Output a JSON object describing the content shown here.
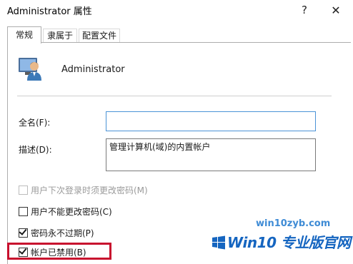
{
  "window": {
    "title": "Administrator 属性",
    "help_label": "?",
    "close_label": "✕"
  },
  "tabs": [
    {
      "label": "常规",
      "active": true
    },
    {
      "label": "隶属于",
      "active": false
    },
    {
      "label": "配置文件",
      "active": false
    }
  ],
  "user": {
    "name": "Administrator",
    "icon": "user-account-icon"
  },
  "fields": {
    "fullname_label": "全名(F):",
    "fullname_value": "",
    "description_label": "描述(D):",
    "description_value": "管理计算机(域)的内置帐户"
  },
  "options": [
    {
      "label": "用户下次登录时须更改密码(M)",
      "checked": false,
      "enabled": false
    },
    {
      "label": "用户不能更改密码(C)",
      "checked": false,
      "enabled": true
    },
    {
      "label": "密码永不过期(P)",
      "checked": true,
      "enabled": true
    },
    {
      "label": "帐户已禁用(B)",
      "checked": true,
      "enabled": true
    }
  ],
  "watermark": {
    "url": "win10zyb.com",
    "brand": "Win10 专业版官网"
  },
  "colors": {
    "highlight": "#c8102e",
    "focus_border": "#4b93d6",
    "watermark_blue": "#1565c0"
  }
}
